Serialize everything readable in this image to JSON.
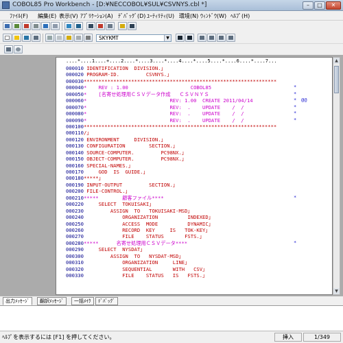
{
  "window": {
    "title": "COBOL85 Pro Workbench - [D:¥NECCOBOL¥SUL¥CSVNYS.cbl *]",
    "min": "–",
    "max": "□",
    "close": "✕"
  },
  "menu": [
    "ﾌｧｲﾙ(F)",
    "編集(E)",
    "表示(V)",
    "ｱﾌﾟﾘｹｰｼｮﾝ(A)",
    "ﾃﾞﾊﾞｯｸﾞ(D)",
    "ﾕｰﾃｨﾘﾃｨ(U)",
    "環境(N)",
    "ｳｨﾝﾄﾞｳ(W)",
    "ﾍﾙﾌﾟ(H)"
  ],
  "search": {
    "value": "SKYKMT",
    "dropdown": "▼"
  },
  "editor": {
    "ruler": "....*....1....+....2....*....3....*....4....*....5....*....6....*....7...",
    "lines": [
      {
        "n": "000010",
        "c": " IDENTIFICATION  DIVISION.」"
      },
      {
        "n": "000020",
        "c": " PROGRAM-ID.         CSVNYS.」"
      },
      {
        "n": "000030",
        "c": "*****************************************************************"
      },
      {
        "n": "000040",
        "c": "*    REV : 1.00                     COBOL85"
      },
      {
        "n": "000050",
        "c": "*    [名寄せ処理用ＣＳＶデータ作成   ＣＳＶＮＹＳ"
      },
      {
        "n": "000060",
        "c": "*                            REV: 1.00  CREATE 2011/04/14"
      },
      {
        "n": "000070",
        "c": "*                            REV:  .    UPDATE    /  /"
      },
      {
        "n": "000080",
        "c": "*                            REV:  .    UPDATE    /  /"
      },
      {
        "n": "000090",
        "c": "*                            REV:  .    UPDATE    /  /"
      },
      {
        "n": "000100",
        "c": "*****************************************************************"
      },
      {
        "n": "000110",
        "c": "/」"
      },
      {
        "n": "000120",
        "c": " ENVIRONMENT     DIVISION.」"
      },
      {
        "n": "000130",
        "c": " CONFIGURATION        SECTION.」"
      },
      {
        "n": "000140",
        "c": " SOURCE-COMPUTER.         PC98NX.」"
      },
      {
        "n": "000150",
        "c": " OBJECT-COMPUTER.         PC98NX.」"
      },
      {
        "n": "000160",
        "c": " SPECIAL-NAMES.」"
      },
      {
        "n": "000170",
        "c": "     GOD  IS  GUIDE.」"
      },
      {
        "n": "000180",
        "c": "*****」"
      },
      {
        "n": "000190",
        "c": " INPUT-OUTPUT         SECTION.」"
      },
      {
        "n": "000200",
        "c": " FILE-CONTROL.」"
      },
      {
        "n": "000210",
        "c": "*****        顧客ファイル****"
      },
      {
        "n": "000220",
        "c": "     SELECT  TOKUISAKI」"
      },
      {
        "n": "000230",
        "c": "         ASSIGN  TO   TOKUISAKI-MSD」"
      },
      {
        "n": "000240",
        "c": "             ORGANIZATION          INDEXED」"
      },
      {
        "n": "000250",
        "c": "             ACCESS  MODE          DYNAMIC」"
      },
      {
        "n": "000260",
        "c": "             RECORD  KEY     IS   TOK-KEY」"
      },
      {
        "n": "000270",
        "c": "             FILE    STATUS       FSTS.」"
      },
      {
        "n": "000280",
        "c": "*****      名寄せ処理用ＣＳＶデータ****"
      },
      {
        "n": "000290",
        "c": "     SELECT  NYSDAT」"
      },
      {
        "n": "000300",
        "c": "         ASSIGN  TO   NYSDAT-MSD」"
      },
      {
        "n": "000310",
        "c": "             ORGANIZATION     LINE」"
      },
      {
        "n": "000320",
        "c": "             SEQUENTIAL       WITH   CSV」"
      },
      {
        "n": "000330",
        "c": "             FILE    STATUS   IS   FSTS.」"
      }
    ]
  },
  "tabs": [
    "出力ﾒｯｾｰｼﾞ",
    "翻訳ﾒｯｾｰｼﾞ",
    "一括ﾒｲｸ",
    "ﾃﾞﾊﾞｯｸﾞ"
  ],
  "status": {
    "text": "ﾍﾙﾌﾟを表示するには [F1] を押してください。",
    "mode": "挿入",
    "position": "1/349"
  },
  "colors": {
    "line_number": "#00008b",
    "code": "#c00000",
    "comment": "#cc00cc",
    "marker": "#1a1ad0"
  }
}
